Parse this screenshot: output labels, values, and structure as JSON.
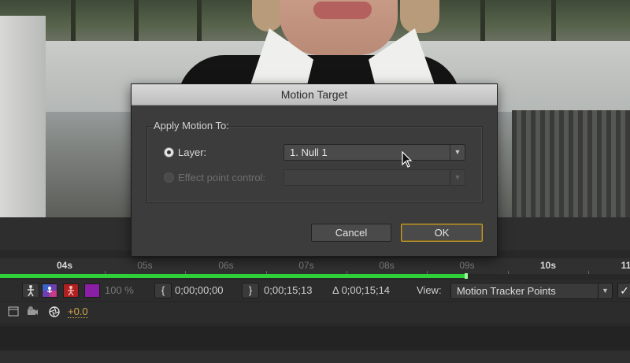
{
  "dialog": {
    "title": "Motion Target",
    "group_label": "Apply Motion To:",
    "layer_option_label": "Layer:",
    "layer_selected": "1. Null 1",
    "effect_option_label": "Effect point control:",
    "effect_value": "",
    "cancel_label": "Cancel",
    "ok_label": "OK"
  },
  "timeline": {
    "ticks": [
      "04s",
      "05s",
      "06s",
      "07s",
      "08s",
      "09s",
      "10s",
      "11"
    ],
    "highlighted_ticks": [
      "04s",
      "10s"
    ],
    "work_area_color": "#2fd13a"
  },
  "controls": {
    "zoom": "100 %",
    "start_time": "0;00;00;00",
    "end_time": "0;00;15;13",
    "duration": "Δ 0;00;15;14",
    "view_label": "View:",
    "view_selected": "Motion Tracker Points",
    "checkbox_mark": "✓",
    "offset_value": "+0.0"
  },
  "colors": {
    "dialog_bg": "#3c3c3c",
    "ok_border": "#c9a230",
    "offset_text": "#d4a74a",
    "swatch_purple": "#8a1fa6"
  }
}
